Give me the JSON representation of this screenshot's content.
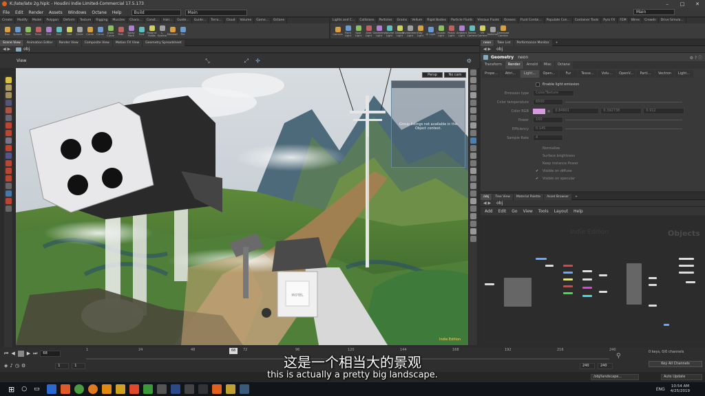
{
  "window": {
    "title": "K:/late/late 2g.hiplc - Houdini Indie Limited-Commercial 17.5.173"
  },
  "menu": {
    "items": [
      "File",
      "Edit",
      "Render",
      "Assets",
      "Windows",
      "Octane",
      "Help"
    ],
    "build_label": "Build",
    "desktop_left": "Main",
    "desktop_right": "Main"
  },
  "shelf_left": {
    "tabs": [
      "Create",
      "Modify",
      "Model",
      "Polygon",
      "Deform",
      "Texture",
      "Rigging",
      "Muscles",
      "Chara...",
      "Const...",
      "Hair...",
      "Guide...",
      "Guide...",
      "Terra...",
      "Cloud",
      "Volume",
      "Game...",
      "Octane"
    ],
    "tools": [
      "Box",
      "Sphere",
      "Tube",
      "Torus",
      "Grid",
      "Null",
      "Line",
      "Circle",
      "Curve",
      "Curve",
      "Draw Curve",
      "Path",
      "Spray Paint",
      "Font",
      "Platonic Solids",
      "L-System",
      "Metaball",
      "File"
    ]
  },
  "shelf_right": {
    "tabs": [
      "Lights and C...",
      "Collisions",
      "Particles",
      "Grains",
      "Vellum",
      "Rigid Bodies",
      "Particle Fluids",
      "Viscous Fluids",
      "Oceans",
      "Fluid Contai...",
      "Populate Con...",
      "Container Tools",
      "Pyro FX",
      "FEM",
      "Wires",
      "Crowds",
      "Drive Simula..."
    ],
    "tools": [
      "Camera",
      "Point Light",
      "Spot Light",
      "Area Light",
      "Geometry Light",
      "Volume Light",
      "Distant Light",
      "Environment Light",
      "Sky Light",
      "GI Light",
      "Caustic Light",
      "Portal Light",
      "Ambient Light",
      "Stereo Camera",
      "VR Camera",
      "Switcher",
      "Gamepad Camera"
    ]
  },
  "left_pane": {
    "tabs": [
      "Scene View",
      "Animation Editor",
      "Render View",
      "Composite View",
      "Motion FX View",
      "Geometry Spreadsheet"
    ],
    "path": "obj",
    "view_label": "View"
  },
  "viewport": {
    "persp": "Persp",
    "cam": "No cam",
    "message": "Group listings not available in the Object context.",
    "watermark": "Indie Edition",
    "sign_text": "MOTEL"
  },
  "param_pane": {
    "tabs": [
      "neon",
      "Take List",
      "Performance Monitor"
    ],
    "path": "obj",
    "node_type": "Geometry",
    "node_name": "neon",
    "main_tabs": [
      "Transform",
      "Render",
      "Arnold",
      "Misc",
      "Octane"
    ],
    "sub_tabs": [
      "Prope...",
      "Attri...",
      "Light...",
      "Open...",
      "Fur",
      "Tesse...",
      "Volu...",
      "OpenV...",
      "Parti...",
      "Vectron",
      "Light..."
    ],
    "enable_light": "Enable light emission",
    "params": [
      {
        "label": "Emission type",
        "value": "Color/Texture"
      },
      {
        "label": "Color temperature",
        "value": "6500"
      },
      {
        "label": "Color RGB",
        "v1": "0.84901",
        "v2": "0.392738",
        "v3": "0.912"
      },
      {
        "label": "Power",
        "value": "100"
      },
      {
        "label": "Efficiency",
        "value": "0.145"
      },
      {
        "label": "Sample Rate",
        "value": "4"
      }
    ],
    "checks": [
      "Normalize",
      "Surface brightness",
      "Keep instance Power",
      "Visible on diffuse",
      "Visible on specular"
    ]
  },
  "network_pane": {
    "tabs": [
      "/obj",
      "Tree View",
      "Material Palette",
      "Asset Browser"
    ],
    "path": "obj",
    "menu": [
      "Add",
      "Edit",
      "Go",
      "View",
      "Tools",
      "Layout",
      "Help"
    ],
    "watermark": "Indie Edition",
    "context": "Objects"
  },
  "timeline": {
    "frame": "68",
    "marker": "68",
    "ticks": [
      "1",
      "24",
      "48",
      "72",
      "96",
      "120",
      "144",
      "168",
      "192",
      "216",
      "240"
    ],
    "start1": "1",
    "start2": "1",
    "end1": "240",
    "end2": "240",
    "keys_label": "0 keys, 0/0 channels",
    "keys_all": "Key All Channels",
    "path": "/obj/landscape...",
    "auto_update": "Auto Update"
  },
  "subtitle": {
    "chinese": "这是一个相当大的景观",
    "english": "this is actually a pretty big landscape."
  },
  "taskbar": {
    "lang": "ENG",
    "time": "10:54 AM",
    "date": "4/25/2019"
  }
}
